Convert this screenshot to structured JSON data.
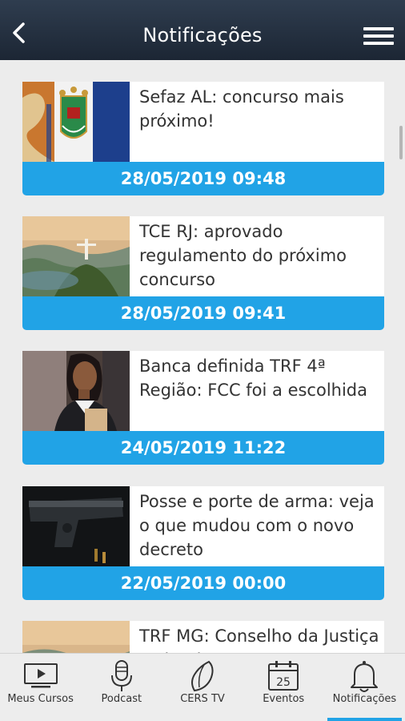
{
  "header": {
    "title": "Notificações",
    "back_icon": "chevron-left-icon",
    "menu_icon": "hamburger-menu-icon"
  },
  "notifications": [
    {
      "headline": "Sefaz AL: concurso mais próximo!",
      "date": "28/05/2019 09:48"
    },
    {
      "headline": "TCE RJ: aprovado regulamento do próximo concurso",
      "date": "28/05/2019 09:41"
    },
    {
      "headline": "Banca definida TRF 4ª Região: FCC foi a escolhida",
      "date": "24/05/2019 11:22"
    },
    {
      "headline": "Posse e porte de arma: veja o que mudou com o novo decreto",
      "date": "22/05/2019 00:00"
    },
    {
      "headline": "TRF MG: Conselho da Justiça Federal",
      "date": ""
    }
  ],
  "tabs": [
    {
      "label": "Meus Cursos",
      "icon": "monitor-play-icon"
    },
    {
      "label": "Podcast",
      "icon": "microphone-icon"
    },
    {
      "label": "CERS TV",
      "icon": "cers-tv-logo-icon"
    },
    {
      "label": "Eventos",
      "icon": "calendar-icon",
      "calendar_day": "25"
    },
    {
      "label": "Notificações",
      "icon": "bell-icon",
      "active": true
    }
  ],
  "colors": {
    "accent": "#21a3e6",
    "header": "#243142",
    "card_text": "#333333"
  }
}
